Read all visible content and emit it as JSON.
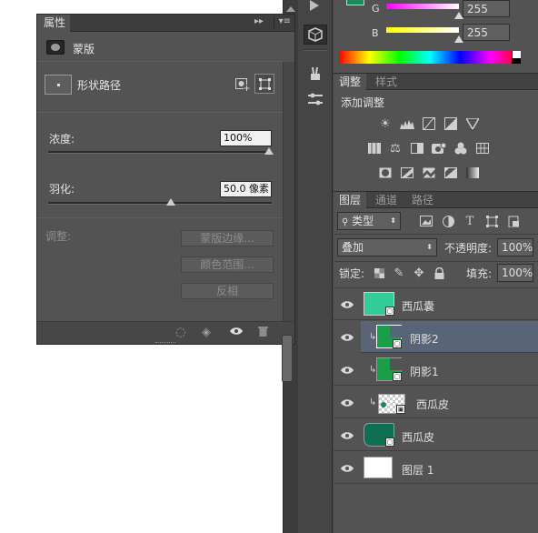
{
  "properties_panel": {
    "tab_label": "属性",
    "section_title": "蒙版",
    "shape_path_label": "形状路径",
    "density": {
      "label": "浓度:",
      "value": "100%",
      "level": 1.0
    },
    "feather": {
      "label": "羽化:",
      "value": "50.0 像素",
      "level": 0.55
    },
    "adjust_label": "调整:",
    "buttons": {
      "mask_edge": "蒙版边缘...",
      "color_range": "颜色范围...",
      "invert": "反相"
    },
    "collapse_glyph": "▸▸",
    "menu_glyph": "▾≡"
  },
  "color_panel": {
    "channels": [
      {
        "label": "G",
        "value": "255"
      },
      {
        "label": "B",
        "value": "255"
      }
    ],
    "g_gradient": [
      "#ff00ff",
      "#ffffff"
    ],
    "b_gradient": [
      "#ffff00",
      "#ffffff"
    ],
    "swatch_color": "#1a8a5a"
  },
  "adjustments_panel": {
    "tabs": [
      "调整",
      "样式"
    ],
    "heading": "添加调整",
    "icons": [
      "brightness-icon",
      "levels-icon",
      "curves-icon",
      "exposure-icon",
      "vibrance-icon",
      "hsl-icon",
      "color-balance-icon",
      "black-white-icon",
      "photo-filter-icon",
      "channel-mixer-icon",
      "color-lookup-icon",
      "invert-icon",
      "posterize-icon",
      "threshold-icon",
      "selective-color-icon",
      "gradient-map-icon"
    ]
  },
  "layers_panel": {
    "tabs": [
      "图层",
      "通道",
      "路径"
    ],
    "filter_label": "类型",
    "blend_mode": "叠加",
    "opacity_label": "不透明度:",
    "opacity_value": "100%",
    "lock_label": "锁定:",
    "fill_label": "填充:",
    "fill_value": "100%",
    "layers": [
      {
        "name": "西瓜囊",
        "thumb_color": "#33cc99",
        "clipped": false,
        "selected": false
      },
      {
        "name": "阴影2",
        "thumb_color": "#1a9e4a",
        "clipped": true,
        "selected": true
      },
      {
        "name": "阴影1",
        "thumb_color": "#1a9e4a",
        "clipped": true,
        "selected": false
      },
      {
        "name": "西瓜皮",
        "thumb_color": "checker",
        "clipped": true,
        "selected": false
      },
      {
        "name": "西瓜皮",
        "thumb_color": "#0f6f52",
        "clipped": false,
        "selected": false
      },
      {
        "name": "图层 1",
        "thumb_color": "#ffffff",
        "clipped": false,
        "selected": false
      }
    ]
  },
  "colors": {
    "panel_bg": "#535353",
    "selected_row": "#596577",
    "dark_bg": "#454545"
  }
}
